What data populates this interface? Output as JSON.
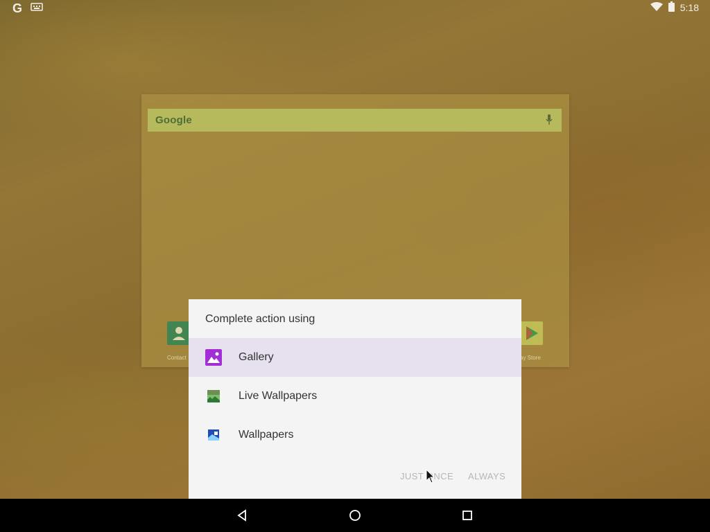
{
  "status_bar": {
    "left_icons": [
      "google-g-icon",
      "keyboard-icon"
    ],
    "google_glyph": "G",
    "time": "5:18",
    "right_icons": [
      "wifi-icon",
      "battery-icon"
    ]
  },
  "home": {
    "search": {
      "logo_text": "Google",
      "mic_icon": "mic-icon"
    },
    "dock": [
      {
        "label": "Contact",
        "icon": "contacts-icon"
      },
      {
        "label": "ay Store",
        "icon": "play-store-icon"
      }
    ]
  },
  "dialog": {
    "title": "Complete action using",
    "apps": [
      {
        "label": "Gallery",
        "icon": "gallery-icon",
        "selected": true
      },
      {
        "label": "Live Wallpapers",
        "icon": "live-wallpapers-icon",
        "selected": false
      },
      {
        "label": "Wallpapers",
        "icon": "wallpapers-icon",
        "selected": false
      }
    ],
    "buttons": {
      "just_once": "JUST ONCE",
      "always": "ALWAYS"
    }
  },
  "nav_bar": {
    "back": "back-icon",
    "home": "home-icon",
    "recents": "recents-icon"
  },
  "colors": {
    "dialog_bg": "#f4f4f4",
    "selected_row": "#e6e0ef",
    "search_bar": "#bec564",
    "disabled_button_text": "#b6b6b6"
  }
}
